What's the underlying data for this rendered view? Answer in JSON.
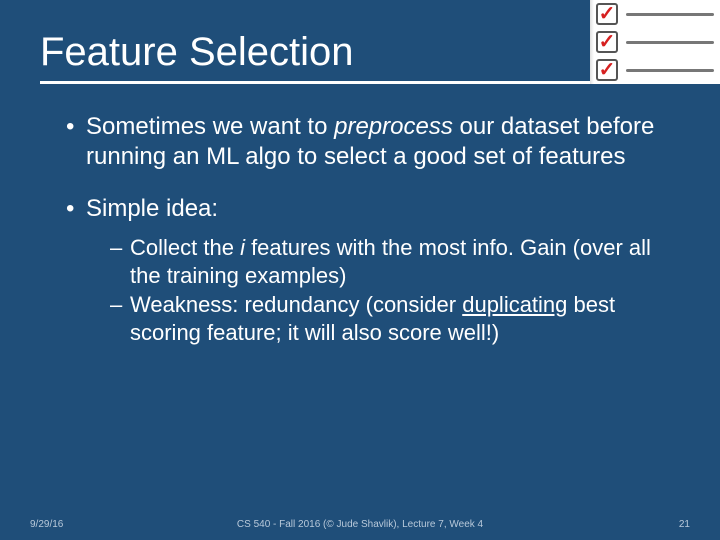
{
  "title": "Feature Selection",
  "bullets": {
    "b1_pre": "Sometimes we want to ",
    "b1_em": "preprocess",
    "b1_post": " our dataset before running an ML algo to select a good set of features",
    "b2": "Simple idea:",
    "s1_pre": "Collect the ",
    "s1_em": "i",
    "s1_post": " features with the most info. Gain (over all the training examples)",
    "s2_pre": "Weakness: redundancy (consider ",
    "s2_u": "duplicating",
    "s2_post": " best scoring feature; it will also score well!)"
  },
  "footer": {
    "date": "9/29/16",
    "center": "CS 540 - Fall 2016 (© Jude Shavlik), Lecture 7, Week 4",
    "page": "21"
  },
  "icon": {
    "name": "checklist-icon"
  }
}
